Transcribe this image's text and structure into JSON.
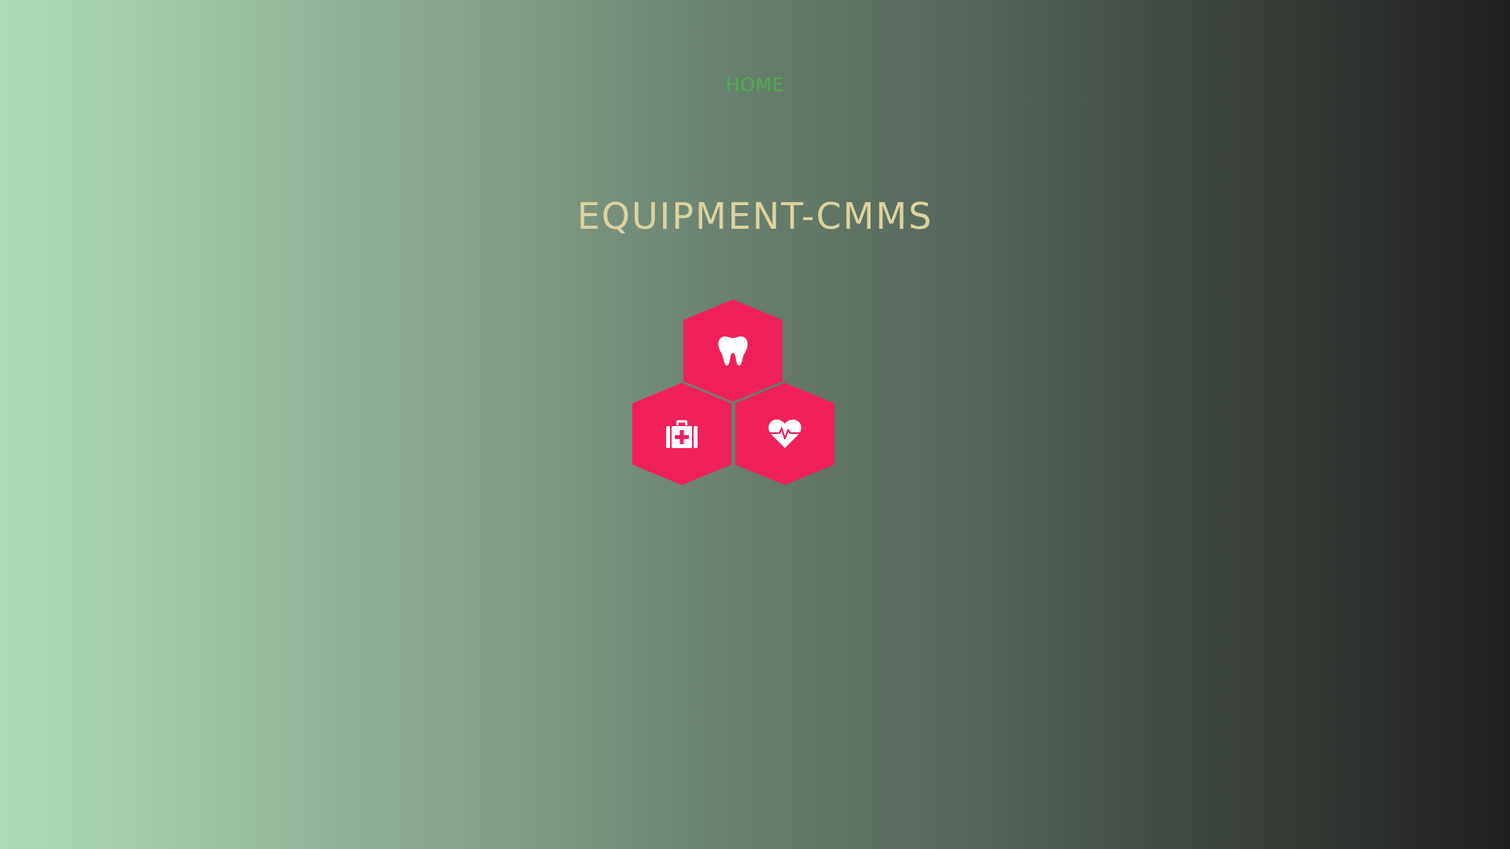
{
  "nav": {
    "home_label": "HOME",
    "home_color": "#4caf50"
  },
  "page": {
    "title": "Equipment-CMMS",
    "title_color": "#dcd3a0"
  },
  "tiles": [
    {
      "icon": "tooth-icon",
      "color": "#f0215a"
    },
    {
      "icon": "medical-kit-icon",
      "color": "#f0215a"
    },
    {
      "icon": "heartbeat-icon",
      "color": "#f0215a"
    }
  ]
}
